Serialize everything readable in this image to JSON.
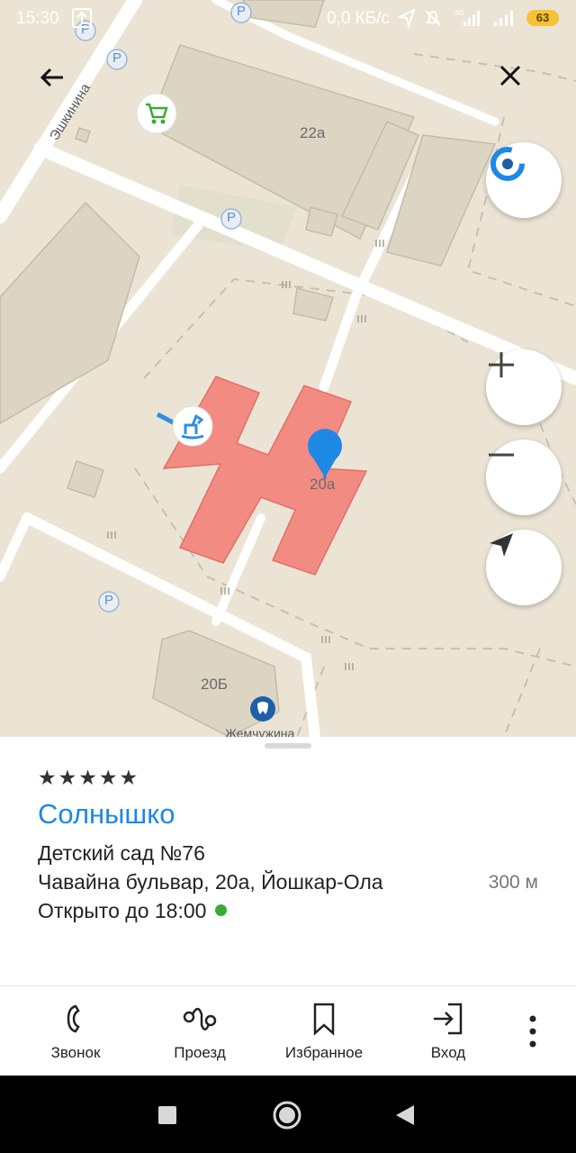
{
  "status_bar": {
    "time": "15:30",
    "net_speed": "0,0 КБ/с",
    "battery": "63",
    "icons": [
      "upload-icon",
      "location-arrow-icon",
      "mute-icon",
      "signal-4g-icon",
      "signal-icon",
      "battery-icon"
    ]
  },
  "map": {
    "street_label": "Эшкинина",
    "building_labels": [
      "22а",
      "20а",
      "20Б"
    ],
    "poi_label": "Жемчужина",
    "parking_label": "P",
    "icons": [
      "back-arrow-icon",
      "close-icon",
      "shopping-cart-icon",
      "toy-horse-icon",
      "tooth-icon",
      "compass-icon",
      "zoom-in-icon",
      "zoom-out-icon",
      "my-location-icon",
      "location-pin-icon"
    ],
    "colors": {
      "ground": "#ebe4d4",
      "building": "#ddd5c3",
      "selected_building": "#f28b82",
      "pin": "#1e88e5",
      "road": "#ffffff"
    }
  },
  "place": {
    "rating_stars": "★★★★★",
    "name": "Солнышко",
    "category": "Детский сад №76",
    "address": "Чавайна бульвар, 20а, Йошкар-Ола",
    "distance": "300 м",
    "hours": "Открыто до 18:00",
    "open_status_color": "#3aaa35"
  },
  "actions": [
    {
      "label": "Звонок",
      "icon": "phone-icon"
    },
    {
      "label": "Проезд",
      "icon": "route-icon"
    },
    {
      "label": "Избранное",
      "icon": "bookmark-icon"
    },
    {
      "label": "Вход",
      "icon": "login-icon"
    }
  ],
  "more_icon": "more-vertical-icon",
  "nav_bar": {
    "icons": [
      "recents-square-icon",
      "home-circle-icon",
      "back-triangle-icon"
    ]
  }
}
